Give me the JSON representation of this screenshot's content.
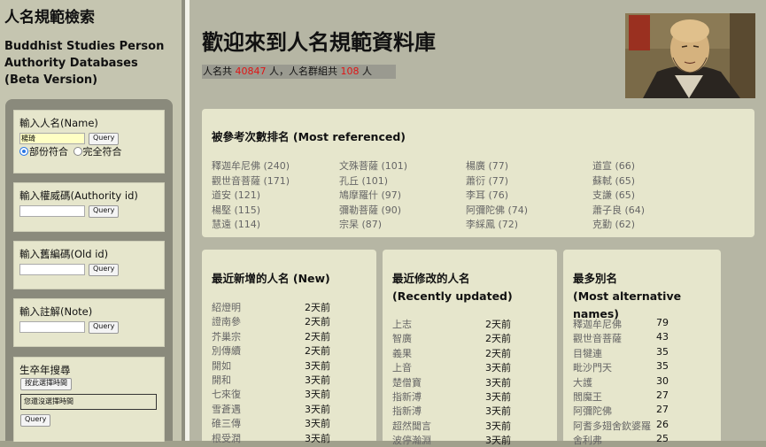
{
  "sidebar": {
    "title": "人名規範檢索",
    "subtitle_lines": [
      "Buddhist Studies Person",
      "Authority Databases",
      "(Beta Version)"
    ],
    "name_search": {
      "label": "輸入人名(Name)",
      "value": "楊琦",
      "button": "Query",
      "options": [
        "部份符合",
        "完全符合"
      ],
      "selected": "部份符合"
    },
    "authority_search": {
      "label": "輸入權威碼(Authority id)",
      "value": "",
      "button": "Query"
    },
    "old_id_search": {
      "label": "輸入舊編碼(Old id)",
      "value": "",
      "button": "Query"
    },
    "note_search": {
      "label": "輸入註解(Note)",
      "value": "",
      "button": "Query"
    },
    "year_search": {
      "label": "生卒年搜尋",
      "select_button": "按此選擇時間",
      "selection_text": "您還沒選擇時間",
      "button": "Query"
    }
  },
  "main": {
    "title": "歡迎來到人名規範資料庫",
    "stats": {
      "prefix": "人名共 ",
      "person_count": "40847",
      "middle": " 人，人名群組共 ",
      "group_count": "108",
      "suffix": " 人"
    },
    "most_referenced": {
      "title": "被參考次數排名  (Most referenced)",
      "columns": [
        [
          "釋迦牟尼佛 (240)",
          "觀世音菩薩 (171)",
          "道安 (121)",
          "楊堅 (115)",
          "慧遠 (114)"
        ],
        [
          "文殊菩薩 (101)",
          "孔丘 (101)",
          "鳩摩羅什 (97)",
          "彌勒菩薩 (90)",
          "宗杲  (87)"
        ],
        [
          "楊廣 (77)",
          "蕭衍 (77)",
          "李耳 (76)",
          "阿彌陀佛 (74)",
          "李綵鳳 (72)"
        ],
        [
          "道宣 (66)",
          "蘇軾 (65)",
          "支謙 (65)",
          "蕭子良 (64)",
          "克勤 (62)"
        ]
      ]
    },
    "new": {
      "title": "最近新增的人名 (New)",
      "rows": [
        {
          "name": "紹燈明",
          "time": "2天前"
        },
        {
          "name": "證南參",
          "time": "2天前"
        },
        {
          "name": "芥巢宗",
          "time": "2天前"
        },
        {
          "name": "別傳續",
          "time": "2天前"
        },
        {
          "name": "開如",
          "time": "3天前"
        },
        {
          "name": "開和",
          "time": "3天前"
        },
        {
          "name": "七來復",
          "time": "3天前"
        },
        {
          "name": "雪蒼遇",
          "time": "3天前"
        },
        {
          "name": "碓三傳",
          "time": "3天前"
        },
        {
          "name": "根受潤",
          "time": "3天前"
        }
      ]
    },
    "updated": {
      "title_lines": [
        "最近修改的人名",
        "(Recently updated)"
      ],
      "rows": [
        {
          "name": "上志",
          "time": "2天前"
        },
        {
          "name": "智廣",
          "time": "2天前"
        },
        {
          "name": "義果",
          "time": "2天前"
        },
        {
          "name": "上音",
          "time": "3天前"
        },
        {
          "name": "楚僧寶",
          "time": "3天前"
        },
        {
          "name": "指新溥",
          "time": "3天前"
        },
        {
          "name": "指新溥",
          "time": "3天前"
        },
        {
          "name": "超然聞言",
          "time": "3天前"
        },
        {
          "name": "波停瀚淵",
          "time": "3天前"
        }
      ]
    },
    "alt_names": {
      "title_lines": [
        "最多別名",
        "(Most alternative names)"
      ],
      "rows": [
        {
          "name": "釋迦牟尼佛",
          "count": "79"
        },
        {
          "name": "觀世音菩薩",
          "count": "43"
        },
        {
          "name": "目犍連",
          "count": "35"
        },
        {
          "name": "毗沙門天",
          "count": "35"
        },
        {
          "name": "大護",
          "count": "30"
        },
        {
          "name": "閻魔王",
          "count": "27"
        },
        {
          "name": "阿彌陀佛",
          "count": "27"
        },
        {
          "name": "阿耆多翅舍欽婆羅",
          "count": "26"
        },
        {
          "name": "舍利弗",
          "count": "25"
        }
      ]
    }
  }
}
